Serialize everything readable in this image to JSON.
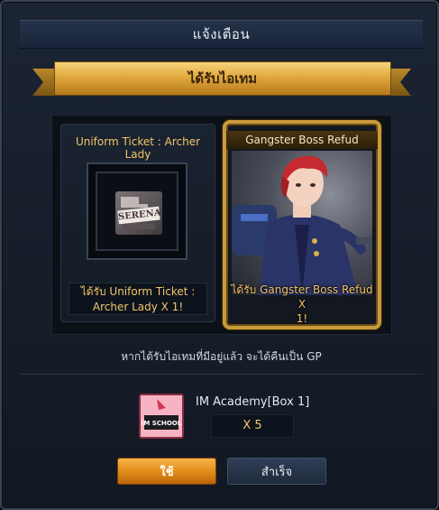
{
  "dialog": {
    "title": "แจ้งเตือน",
    "ribbon_text": "ได้รับไอเทม"
  },
  "reward_left": {
    "title": "Uniform Ticket : Archer Lady",
    "icon_text": "SERENA",
    "desc_line1": "ได้รับ Uniform Ticket :",
    "desc_line2": "Archer Lady X 1!"
  },
  "reward_right": {
    "title": "Gangster Boss Refud",
    "desc_line1": "ได้รับ Gangster Boss Refud X",
    "desc_line2": "1!"
  },
  "notice": "หากได้รับไอเทมที่มีอยู่แล้ว จะได้คืนเป็น GP",
  "box_item": {
    "name": "IM Academy[Box 1]",
    "quantity": "X 5",
    "icon_text": "IM SCHOOL"
  },
  "buttons": {
    "use_label": "ใช้",
    "done_label": "สำเร็จ"
  },
  "colors": {
    "accent_gold": "#f2c66a",
    "button_orange": "#e08a17",
    "panel_dark": "#161d29"
  }
}
